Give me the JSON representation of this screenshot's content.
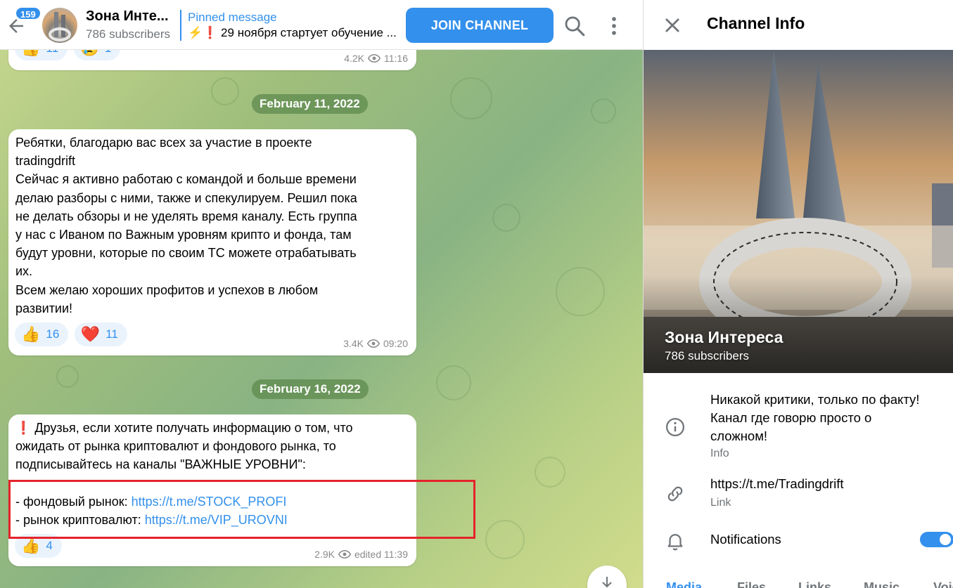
{
  "header": {
    "unread_count": "159",
    "channel_title": "Зона Инте...",
    "subscribers": "786 subscribers",
    "pinned_label": "Pinned message",
    "pinned_text": "⚡❗ 29 ноября стартует обучение ...",
    "join_label": "JOIN CHANNEL"
  },
  "chat": {
    "prev_message": {
      "reactions": [
        {
          "emoji": "👍",
          "count": "11"
        },
        {
          "emoji": "😢",
          "count": "1"
        }
      ],
      "views": "4.2K",
      "time": "11:16"
    },
    "date1": "February 11, 2022",
    "message1": {
      "lines": [
        "Ребятки, благодарю вас всех за участие в проекте",
        "tradingdrift",
        "Сейчас я активно работаю с командой и больше времени",
        "делаю разборы с ними, также и спекулируем. Решил пока",
        "не делать обзоры и не уделять время каналу. Есть группа",
        "у нас с Иваном по Важным уровням крипто и фонда, там",
        "будут уровни, которые по своим ТС можете отрабатывать",
        "их.",
        "Всем желаю хороших профитов и успехов в любом",
        "развитии!"
      ],
      "reactions": [
        {
          "emoji": "👍",
          "count": "16"
        },
        {
          "emoji": "❤️",
          "count": "11"
        }
      ],
      "views": "3.4K",
      "time": "09:20"
    },
    "date2": "February 16, 2022",
    "message2": {
      "lines": [
        "❗ Друзья, если хотите получать информацию о том, что",
        "ожидать от рынка криптовалют и фондового рынка, то",
        "подписывайтесь на каналы \"ВАЖНЫЕ УРОВНИ\":"
      ],
      "stock_label": "- фондовый рынок: ",
      "stock_link": "https://t.me/STOCK_PROFI",
      "crypto_label": "- рынок криптовалют: ",
      "crypto_link": "https://t.me/VIP_UROVNI",
      "reactions": [
        {
          "emoji": "👍",
          "count": "4"
        }
      ],
      "views": "2.9K",
      "time": "edited 11:39"
    }
  },
  "info": {
    "title": "Channel Info",
    "name": "Зона Интереса",
    "subscribers": "786 subscribers",
    "description_lines": [
      "Никакой критики, только по факту!",
      "Канал где говорю просто о",
      "сложном!"
    ],
    "description_caption": "Info",
    "link": "https://t.me/Tradingdrift",
    "link_caption": "Link",
    "notifications_label": "Notifications",
    "notifications_on": true,
    "tabs": [
      "Media",
      "Files",
      "Links",
      "Music",
      "Voice"
    ]
  },
  "colors": {
    "accent": "#3390ec",
    "highlight_box": "#e5232b"
  }
}
